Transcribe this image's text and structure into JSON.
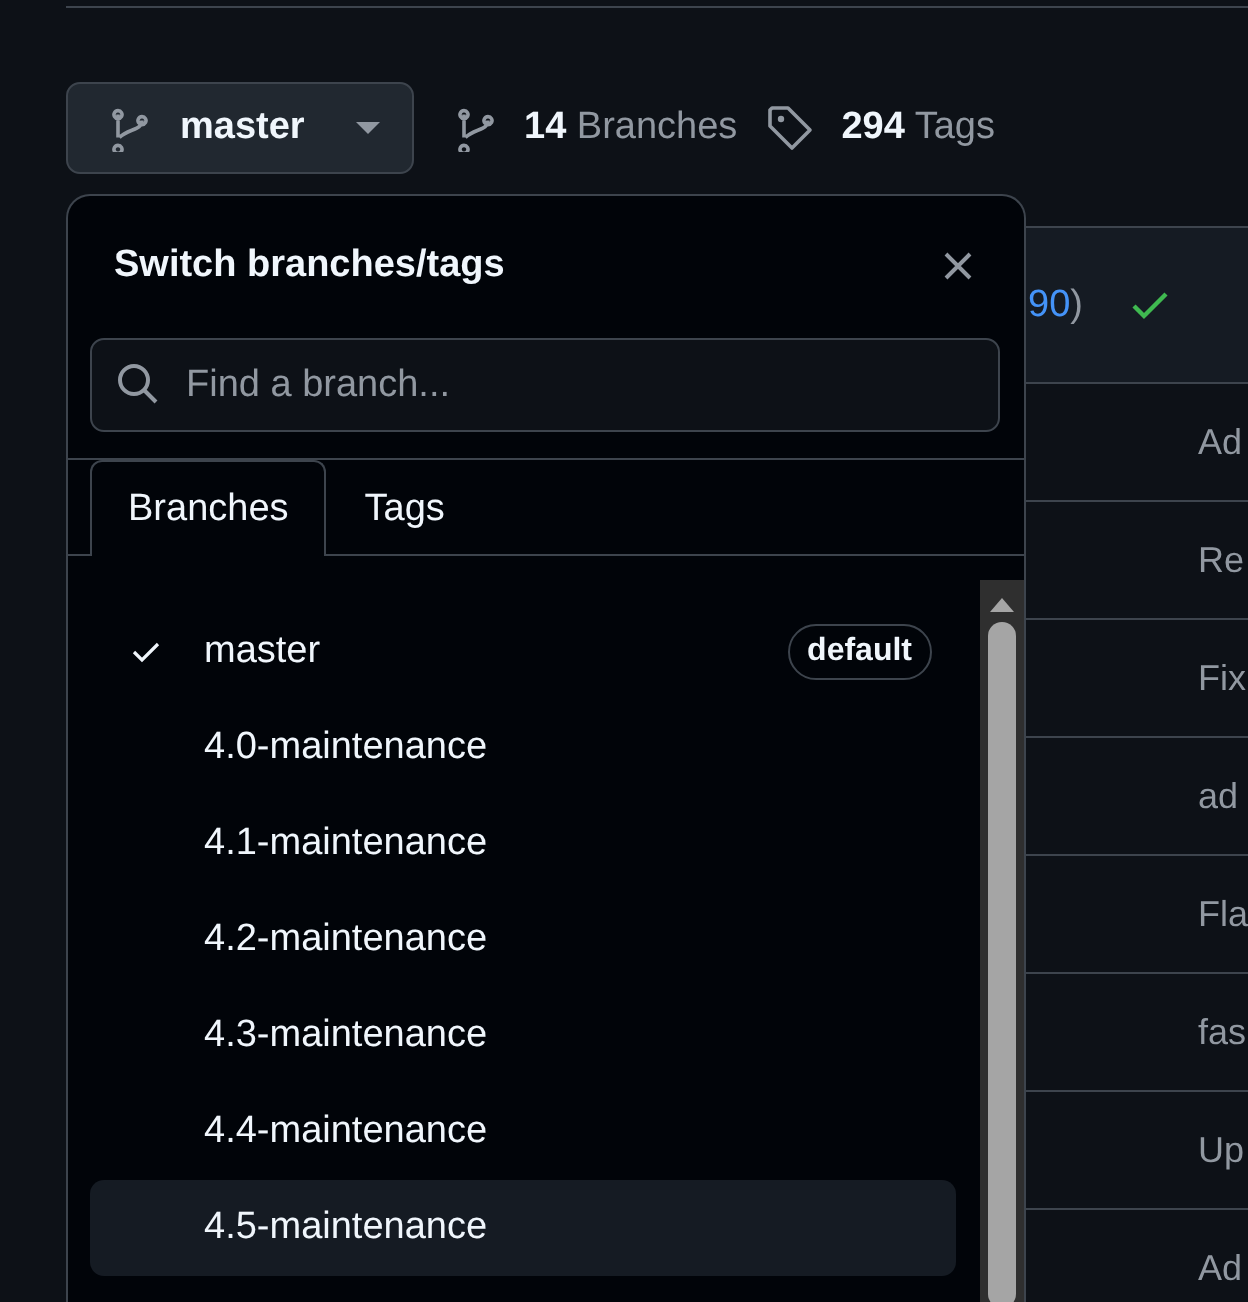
{
  "toolbar": {
    "branch_button": {
      "label": "master"
    },
    "branches_link": "**14** Branches",
    "tags_link": "**294** Tags"
  },
  "commits": {
    "header": {
      "link": "90",
      "text": ")",
      "checks_passed": true
    },
    "rows": [
      {
        "message": "Ad"
      },
      {
        "message": "Re"
      },
      {
        "message": "Fix"
      },
      {
        "message": "ad"
      },
      {
        "message": "Fla"
      },
      {
        "message": "fas"
      },
      {
        "message": "Up"
      },
      {
        "message": "Ad"
      }
    ]
  },
  "popup": {
    "title": "Switch branches/tags",
    "search": {
      "placeholder": "Find a branch..."
    },
    "tabs": [
      {
        "label": "Branches",
        "selected": true
      },
      {
        "label": "Tags",
        "selected": false
      }
    ],
    "items": [
      {
        "name": "master",
        "checked": true,
        "badge": "default",
        "highlighted": false
      },
      {
        "name": "4.0-maintenance",
        "checked": false,
        "highlighted": false
      },
      {
        "name": "4.1-maintenance",
        "checked": false,
        "highlighted": false
      },
      {
        "name": "4.2-maintenance",
        "checked": false,
        "highlighted": false
      },
      {
        "name": "4.3-maintenance",
        "checked": false,
        "highlighted": false
      },
      {
        "name": "4.4-maintenance",
        "checked": false,
        "highlighted": false
      },
      {
        "name": "4.5-maintenance",
        "checked": false,
        "highlighted": true
      }
    ]
  }
}
